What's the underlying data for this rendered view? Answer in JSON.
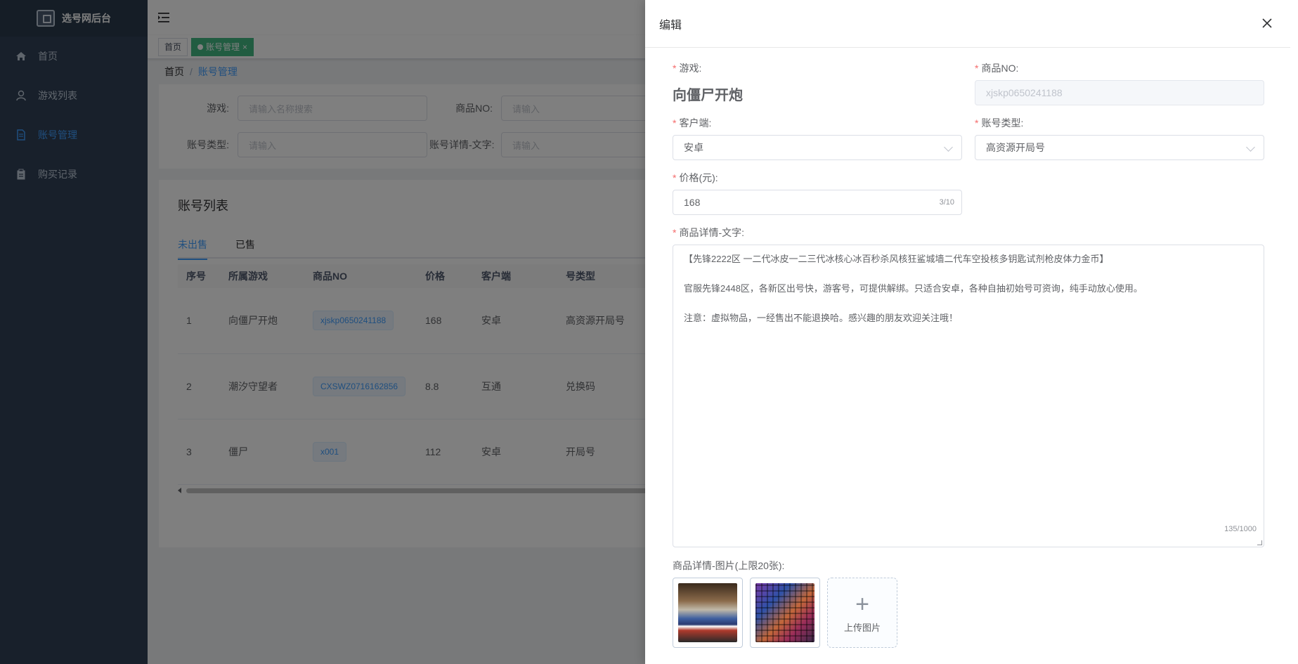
{
  "app": {
    "title": "选号网后台"
  },
  "sidebar": {
    "items": [
      {
        "label": "首页",
        "icon": "home-icon"
      },
      {
        "label": "游戏列表",
        "icon": "user-icon"
      },
      {
        "label": "账号管理",
        "icon": "document-icon",
        "active": true
      },
      {
        "label": "购买记录",
        "icon": "clipboard-icon"
      }
    ]
  },
  "tags": {
    "home": "首页",
    "current": "账号管理",
    "close": "×"
  },
  "breadcrumb": {
    "home": "首页",
    "sep": "/",
    "current": "账号管理"
  },
  "search": {
    "game_label": "游戏:",
    "game_placeholder": "请输入名称搜索",
    "no_label": "商品NO:",
    "no_placeholder": "请输入",
    "type_label": "账号类型:",
    "type_placeholder": "请输入",
    "detail_label": "账号详情-文字:",
    "detail_placeholder": "请输入"
  },
  "list": {
    "title": "账号列表",
    "tabs": [
      "未出售",
      "已售"
    ],
    "headers": [
      "序号",
      "所属游戏",
      "商品NO",
      "价格",
      "客户端",
      "号类型"
    ],
    "rows": [
      {
        "idx": "1",
        "game": "向僵尸开炮",
        "no": "xjskp0650241188",
        "price": "168",
        "client": "安卓",
        "type": "高资源开局号"
      },
      {
        "idx": "2",
        "game": "潮汐守望者",
        "no": "CXSWZ0716162856",
        "price": "8.8",
        "client": "互通",
        "type": "兑换码"
      },
      {
        "idx": "3",
        "game": "僵尸",
        "no": "x001",
        "price": "112",
        "client": "安卓",
        "type": "开局号"
      }
    ]
  },
  "drawer": {
    "title": "编辑",
    "close": "×",
    "game_label": "游戏:",
    "game_value": "向僵尸开炮",
    "no_label": "商品NO:",
    "no_value": "xjskp0650241188",
    "client_label": "客户端:",
    "client_value": "安卓",
    "type_label": "账号类型:",
    "type_value": "高资源开局号",
    "price_label": "价格(元):",
    "price_value": "168",
    "price_count": "3/10",
    "detail_label": "商品详情-文字:",
    "detail_lines": [
      "【先锋2222区 一二代冰皮一二三代冰核心冰百秒杀风核狂鲨城墙二代车空投核多钥匙试剂枪皮体力金币】",
      "官服先锋2448区，各新区出号快，游客号，可提供解绑。只适合安卓，各种自抽初始号可资询，纯手动放心使用。",
      "注意：虚拟物品，一经售出不能退换哈。感兴趣的朋友欢迎关注哦！"
    ],
    "detail_count": "135/1000",
    "images_label": "商品详情-图片(上限20张):",
    "upload_label": "上传图片"
  }
}
